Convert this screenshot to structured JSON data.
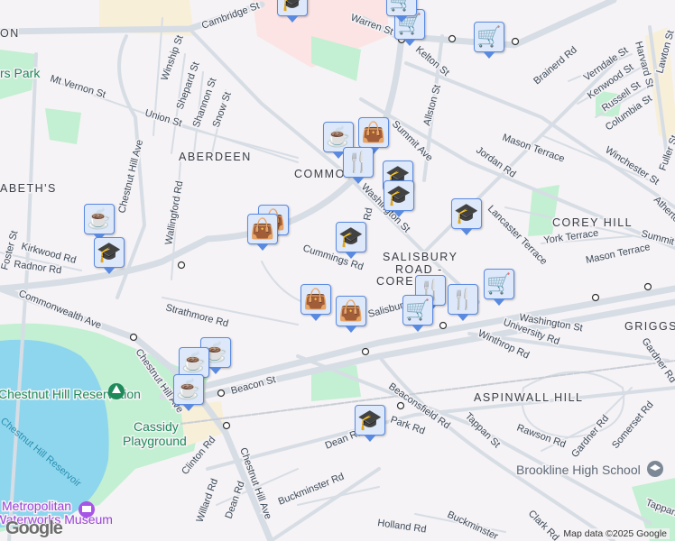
{
  "map": {
    "neighborhoods": [
      "ON",
      "ABERDEEN",
      "COMMON",
      "ABETH'S",
      "COREY HILL",
      "SALISBURY",
      "ROAD -",
      "CORE",
      "GRIGGS",
      "ASPINWALL HILL"
    ],
    "streets": [
      "Mt Vernon St",
      "Winship St",
      "Shepard St",
      "Shannon St",
      "Snow St",
      "Union St",
      "Chestnut Hill Ave",
      "Wallingford Rd",
      "Kirkwood Rd",
      "Radnor Rd",
      "Foster St",
      "Cambridge St",
      "Warren St",
      "Kelton St",
      "Allston St",
      "Brainerd Rd",
      "Verndale St",
      "Kenwood St",
      "Russell St",
      "Columbia St",
      "Harvard St",
      "Lawton St",
      "Fuller St",
      "Summit Ave",
      "Mason Terrace",
      "Jordan Rd",
      "Winchester St",
      "Washington St",
      "York Terrace",
      "Mason Terrace",
      "Lancaster Terrace",
      "Summit",
      "Atherton",
      "Cummings Rd",
      "Strathmore Rd",
      "Commonwealth Ave",
      "Chestnut Hill Ave",
      "Beacon St",
      "Salisbury",
      "Washington St",
      "University Rd",
      "Winthrop Rd",
      "Gardner Rd",
      "Beaconsfield Rd",
      "Tappan St",
      "Rawson Rd",
      "Gardner Rd",
      "Somerset Rd",
      "Clinton Rd",
      "Willard Rd",
      "Dean Rd",
      "Chestnut Hill Ave",
      "Buckminster Rd",
      "Dean Rd",
      "Park Rd",
      "Holland Rd",
      "Buckminster",
      "Clark Rd",
      "Tappan",
      "Rd"
    ],
    "pois": {
      "park1": "rs Park",
      "reservation": "Chestnut Hill Reservation",
      "reservoir": "Chestnut Hill Reservoir",
      "playground_1": "Cassidy",
      "playground_2": "Playground",
      "museum_1": "Metropolitan",
      "museum_2": "Waterworks Museum",
      "school": "Brookline High School"
    },
    "markers": [
      "shopping-cart",
      "shopping-cart",
      "shopping-cart",
      "graduation-cap",
      "coffee-cup",
      "shopping-bag",
      "restaurant",
      "graduation-cap",
      "graduation-cap",
      "graduation-cap",
      "shopping-bag",
      "coffee-cup",
      "graduation-cap",
      "shopping-bag",
      "shopping-bag",
      "restaurant",
      "shopping-cart",
      "restaurant",
      "shopping-cart",
      "coffee-cup",
      "coffee-cup",
      "graduation-cap"
    ],
    "attribution": "Map data ©2025 Google",
    "logo": "Google",
    "colors": {
      "background": "#f5f3f5",
      "road": "#d7dde5",
      "park": "#c3efd2",
      "water": "#8ed6ee",
      "marker_fill": "#dde8fb",
      "marker_border": "#5a8ae0",
      "icon": "#0b4467"
    }
  }
}
